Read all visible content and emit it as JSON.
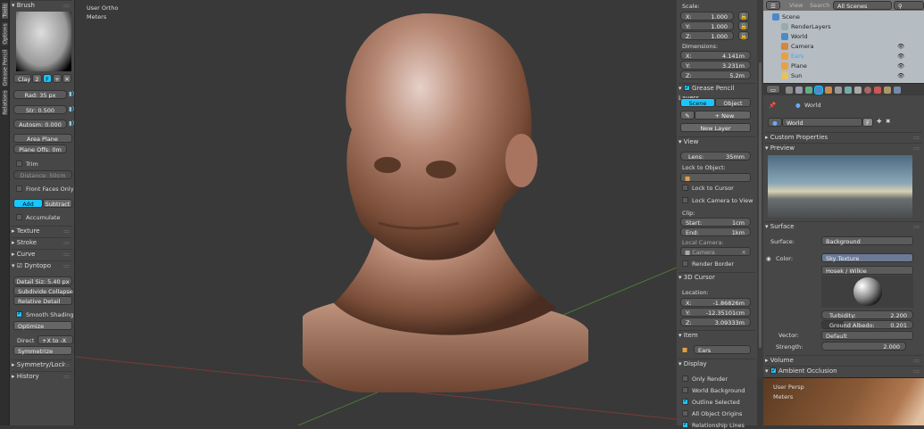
{
  "left_tabs": [
    "Tools",
    "Options",
    "Grease Pencil",
    "Relations"
  ],
  "brush": {
    "header": "Brush",
    "brush_name": "Clay",
    "users": "2",
    "fake_user": "F",
    "radius": "Rad: 35 px",
    "strength_label": "Str:",
    "strength": "0.500",
    "autosmooth": "Autosm: 0.000",
    "plane": "Area Plane",
    "plane_offset": "Plane Offs: 0m",
    "trim": "Trim",
    "distance_label": "Distance:",
    "distance": "50cm",
    "front_faces_only": "Front Faces Only",
    "add": "Add",
    "subtract": "Subtract",
    "accumulate": "Accumulate"
  },
  "sections": {
    "texture": "Texture",
    "stroke": "Stroke",
    "curve": "Curve",
    "dyntopo": "Dyntopo",
    "symmetry": "Symmetry/Lock",
    "history": "History"
  },
  "dyntopo": {
    "detail_size": "Detail Siz: 5.40 px",
    "method": "Subdivide Collapse",
    "detail_type": "Relative Detail",
    "smooth_shading": "Smooth Shading",
    "optimize": "Optimize",
    "direction_label": "Direct",
    "direction": "+X to -X",
    "symmetrize": "Symmetrize"
  },
  "viewport": {
    "view_name": "User Ortho",
    "units": "Meters"
  },
  "npanel": {
    "scale_label": "Scale:",
    "scale": [
      {
        "axis": "X:",
        "value": "1.000"
      },
      {
        "axis": "Y:",
        "value": "1.000"
      },
      {
        "axis": "Z:",
        "value": "1.000"
      }
    ],
    "dimensions_label": "Dimensions:",
    "dimensions": [
      {
        "axis": "X:",
        "value": "4.141m"
      },
      {
        "axis": "Y:",
        "value": "3.231m"
      },
      {
        "axis": "Z:",
        "value": "5.2m"
      }
    ],
    "gp_header": "Grease Pencil Layers",
    "gp_scene": "Scene",
    "gp_object": "Object",
    "gp_new": "New",
    "gp_new_layer": "New Layer",
    "view_header": "View",
    "lens_label": "Lens:",
    "lens": "35mm",
    "lock_object_label": "Lock to Object:",
    "lock_cursor": "Lock to Cursor",
    "lock_camera": "Lock Camera to View",
    "clip_label": "Clip:",
    "clip_start_label": "Start:",
    "clip_start": "1cm",
    "clip_end_label": "End:",
    "clip_end": "1km",
    "local_camera_label": "Local Camera:",
    "local_camera": "Camera",
    "render_border": "Render Border",
    "cursor_header": "3D Cursor",
    "location_label": "Location:",
    "cursor": [
      {
        "axis": "X:",
        "value": "-1.86826m"
      },
      {
        "axis": "Y:",
        "value": "-12.35101cm"
      },
      {
        "axis": "Z:",
        "value": "3.09333m"
      }
    ],
    "item_header": "Item",
    "item_name": "Ears",
    "display_header": "Display",
    "display": [
      {
        "label": "Only Render",
        "checked": false
      },
      {
        "label": "World Background",
        "checked": false
      },
      {
        "label": "Outline Selected",
        "checked": true
      },
      {
        "label": "All Object Origins",
        "checked": false
      },
      {
        "label": "Relationship Lines",
        "checked": true
      }
    ]
  },
  "outliner": {
    "view": "View",
    "search": "Search",
    "scenes": "All Scenes",
    "items": [
      {
        "name": "Scene"
      },
      {
        "name": "RenderLayers"
      },
      {
        "name": "World"
      },
      {
        "name": "Camera"
      },
      {
        "name": "Ears",
        "selected": true
      },
      {
        "name": "Plane"
      },
      {
        "name": "Sun"
      }
    ]
  },
  "properties": {
    "breadcrumb": "World",
    "world_name": "World",
    "fake": "F",
    "custom_props": "Custom Properties",
    "preview": "Preview",
    "surface_header": "Surface",
    "surface_label": "Surface:",
    "surface": "Background",
    "color_label": "Color:",
    "color": "Sky Texture",
    "sky_type": "Hosek / Wilkie",
    "turbidity_label": "Turbidity:",
    "turbidity": "2.200",
    "albedo_label": "Ground Albedo:",
    "albedo": "0.201",
    "vector_label": "Vector:",
    "vector": "Default",
    "strength_label": "Strength:",
    "strength": "2.000",
    "volume": "Volume",
    "ao": "Ambient Occlusion"
  },
  "bottom_view": {
    "view_name": "User Persp",
    "units": "Meters"
  },
  "colors": {
    "accent": "#19c6ff",
    "panel": "#474747",
    "viewport": "#393939",
    "skin": "#b08068"
  }
}
